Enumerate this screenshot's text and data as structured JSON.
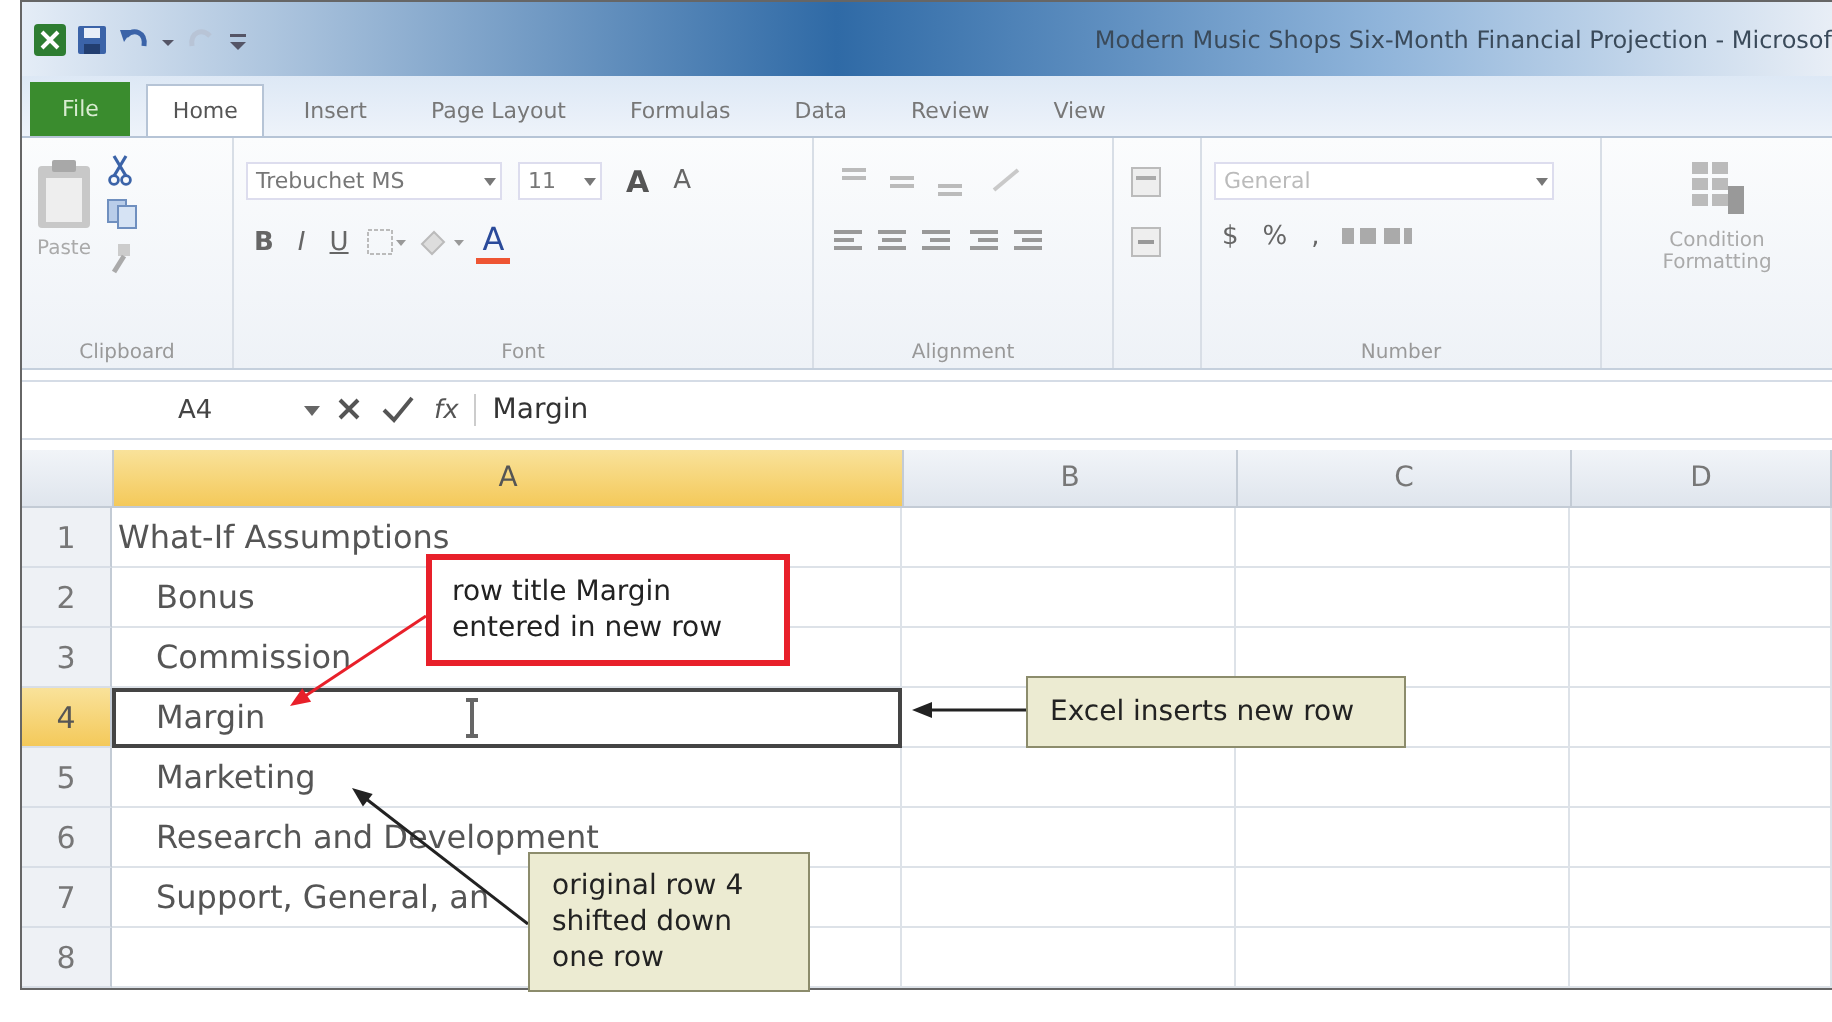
{
  "window": {
    "title": "Modern Music Shops Six-Month Financial Projection - Microsof"
  },
  "tabs": [
    {
      "label": "File",
      "kind": "file",
      "selected": false
    },
    {
      "label": "Home",
      "kind": "tab",
      "selected": true
    },
    {
      "label": "Insert",
      "kind": "tab",
      "selected": false
    },
    {
      "label": "Page Layout",
      "kind": "tab",
      "selected": false
    },
    {
      "label": "Formulas",
      "kind": "tab",
      "selected": false
    },
    {
      "label": "Data",
      "kind": "tab",
      "selected": false
    },
    {
      "label": "Review",
      "kind": "tab",
      "selected": false
    },
    {
      "label": "View",
      "kind": "tab",
      "selected": false
    }
  ],
  "ribbon": {
    "clipboard": {
      "label": "Clipboard",
      "paste": "Paste"
    },
    "font": {
      "label": "Font",
      "name": "Trebuchet MS",
      "size": "11",
      "grow": "A",
      "shrink": "A",
      "bold": "B",
      "italic": "I",
      "underline": "U",
      "font_color_label": "A"
    },
    "alignment": {
      "label": "Alignment"
    },
    "number": {
      "label": "Number",
      "format": "General",
      "currency": "$",
      "percent": "%",
      "comma": ","
    },
    "styles": {
      "conditional": [
        "Condition",
        "Formatting"
      ]
    }
  },
  "formula_bar": {
    "name_box": "A4",
    "function_label": "fx",
    "value": "Margin"
  },
  "sheet": {
    "columns": [
      {
        "label": "A",
        "selected": true
      },
      {
        "label": "B",
        "selected": false
      },
      {
        "label": "C",
        "selected": false
      },
      {
        "label": "D",
        "selected": false
      }
    ],
    "rows": [
      {
        "number": "1",
        "selected": false,
        "indented": false,
        "cell_a": "What-If Assumptions"
      },
      {
        "number": "2",
        "selected": false,
        "indented": true,
        "cell_a": "Bonus"
      },
      {
        "number": "3",
        "selected": false,
        "indented": true,
        "cell_a": "Commission"
      },
      {
        "number": "4",
        "selected": true,
        "indented": true,
        "cell_a": "Margin"
      },
      {
        "number": "5",
        "selected": false,
        "indented": true,
        "cell_a": "Marketing"
      },
      {
        "number": "6",
        "selected": false,
        "indented": true,
        "cell_a": "Research and Development"
      },
      {
        "number": "7",
        "selected": false,
        "indented": true,
        "cell_a": "Support, General, an"
      },
      {
        "number": "8",
        "selected": false
      }
    ]
  },
  "callouts": [
    {
      "kind": "highlight",
      "lines": [
        "row title Margin",
        "entered in new row"
      ]
    },
    {
      "kind": "note",
      "lines": [
        "Excel inserts new row"
      ]
    },
    {
      "kind": "note",
      "lines": [
        "original row 4",
        "shifted down",
        "one row"
      ]
    }
  ]
}
